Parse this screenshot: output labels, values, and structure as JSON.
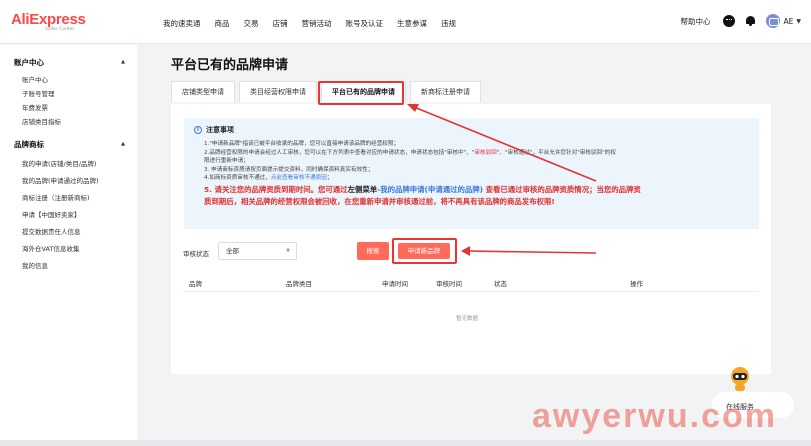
{
  "logo": {
    "text": "AliExpress",
    "sub": "Seller Center"
  },
  "nav": {
    "items": [
      "我的速卖通",
      "商品",
      "交易",
      "店铺",
      "营销活动",
      "账号及认证",
      "生意参谋",
      "违规"
    ],
    "help": "帮助中心",
    "user": "AE"
  },
  "sidebar": {
    "sections": [
      {
        "title": "账户中心",
        "items": [
          "账户中心",
          "子账号管理",
          "年费发票",
          "店铺类目指标"
        ]
      },
      {
        "title": "品牌商标",
        "items": [
          "我的申请(店铺/类目/品牌)",
          "我的品牌(申请通过的品牌)",
          "商标注册（注册新商标)",
          "申请【中国好卖家】",
          "提交数据责任人信息",
          "海外仓VAT信息收集",
          "我的信息"
        ]
      }
    ]
  },
  "page": {
    "title": "平台已有的品牌申请"
  },
  "tabs": [
    "店铺类型申请",
    "类目经营权限申请",
    "平台已有的品牌申请",
    "新商标注册申请"
  ],
  "notice": {
    "title": "注意事项",
    "line1": "1.\"申请新品牌\"指该已被平台收录的品牌，您可以直接申请该品牌的经营权限；",
    "line2a": "2.品牌经营权限的申请会经过人工审核，您可以在下方列表中查看对应的申请状态，申请状态包括\"审核中\"、\"",
    "line2b": "审核驳回",
    "line2c": "\"、\"审核通过\"，平台允许您针对\"审核驳回\"的权",
    "line2d": "限进行重新申请；",
    "line3": "3. 申请商标资质请按页面提示提交资料，同时确保资料真实有效性；",
    "line4a": "4.如商标资质审核不通过，",
    "line4b": "点此查看审核不通原因",
    "line4c": "；",
    "line5a": "5. 请关注您的品牌资质到期时间。您可通过",
    "line5b": "左侧菜单",
    "line5c": "-我的品牌申请(申请通过的品牌)",
    "line5d": " 查看已通过审核的品牌资质情况；当您的品牌资",
    "line5e": "质到期后，相关品牌的经营权限会被回收，在您重新申请并审核通过前，将不再具有该品牌的商品发布权限!"
  },
  "filter": {
    "label": "审核状态",
    "value": "全部"
  },
  "buttons": {
    "search": "搜索",
    "apply": "申请新品牌"
  },
  "table": {
    "columns": [
      "品牌",
      "品牌类目",
      "申请时间",
      "审核时间",
      "状态",
      "操作"
    ],
    "empty": "暂无数据"
  },
  "chat": {
    "label": "在线服务"
  },
  "watermark": "awyerwu.com",
  "colors": {
    "brand": "#ff4747",
    "accent": "#ff6a5a",
    "annotation": "#e33333",
    "link": "#3a7bd5"
  }
}
